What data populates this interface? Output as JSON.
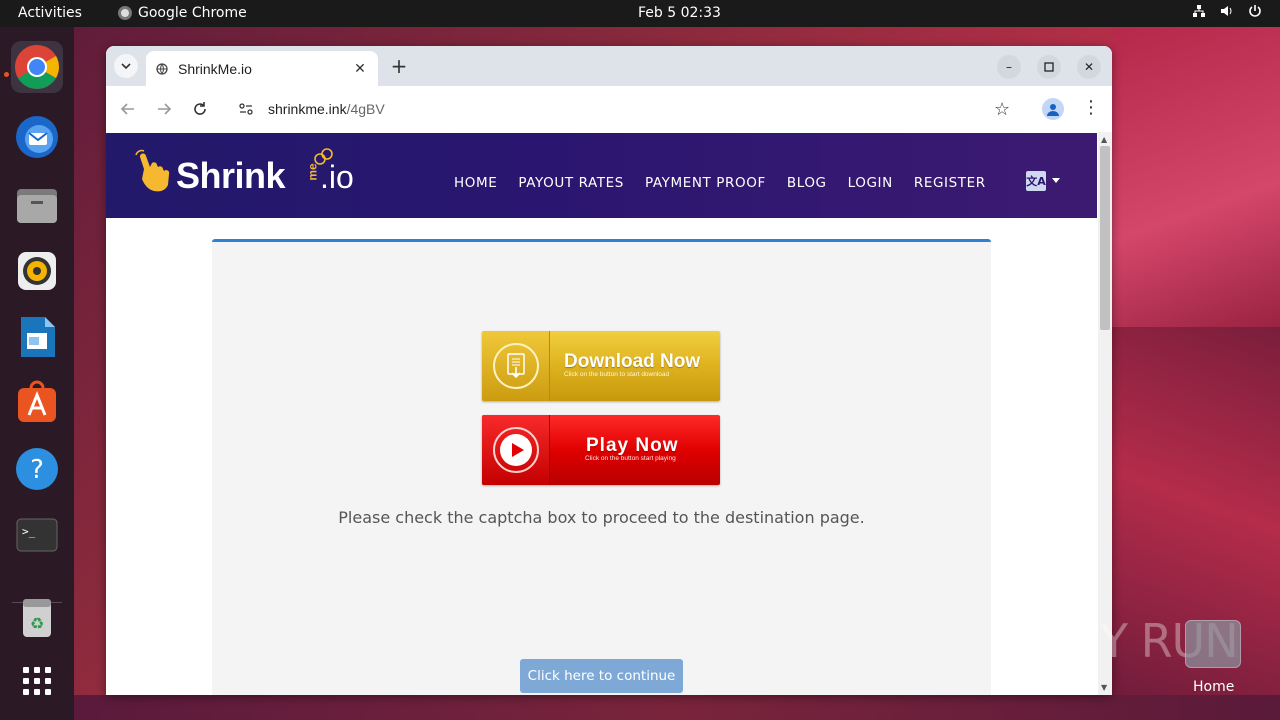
{
  "topbar": {
    "activities": "Activities",
    "app_name": "Google Chrome",
    "clock": "Feb 5  02:33"
  },
  "dock": {
    "items": [
      {
        "name": "chrome",
        "icon": "chrome-icon"
      },
      {
        "name": "thunderbird",
        "icon": "thunderbird-icon"
      },
      {
        "name": "files",
        "icon": "files-icon"
      },
      {
        "name": "rhythmbox",
        "icon": "rhythmbox-icon"
      },
      {
        "name": "libreoffice-writer",
        "icon": "writer-icon"
      },
      {
        "name": "app-center",
        "icon": "app-center-icon"
      },
      {
        "name": "help",
        "icon": "help-icon"
      },
      {
        "name": "terminal",
        "icon": "terminal-icon"
      },
      {
        "name": "trash",
        "icon": "trash-icon"
      },
      {
        "name": "show-apps",
        "icon": "app-grid-icon"
      }
    ]
  },
  "browser": {
    "tab_title": "ShrinkMe.io",
    "url_host": "shrinkme.ink",
    "url_path": "/4gBV"
  },
  "site": {
    "logo_main": "Shrink",
    "logo_me": "me",
    "logo_io": ".io",
    "nav": [
      "HOME",
      "PAYOUT RATES",
      "PAYMENT PROOF",
      "BLOG",
      "LOGIN",
      "REGISTER"
    ],
    "download_button": {
      "title": "Download Now",
      "subtitle": "Click on the button to start download"
    },
    "play_button": {
      "title": "Play Now",
      "subtitle": "Click on the button start playing"
    },
    "captcha_message": "Please check the captcha box to proceed to the destination page.",
    "continue_label": "Click here to continue"
  },
  "desktop": {
    "watermark": "ANY RUN",
    "home_label": "Home"
  },
  "colors": {
    "header_start": "#22196a",
    "header_end": "#3d1a72",
    "card_accent": "#2f7fd6",
    "continue_button": "#7ea9d6",
    "download_gold": "#deb21f",
    "play_red": "#e00000"
  }
}
